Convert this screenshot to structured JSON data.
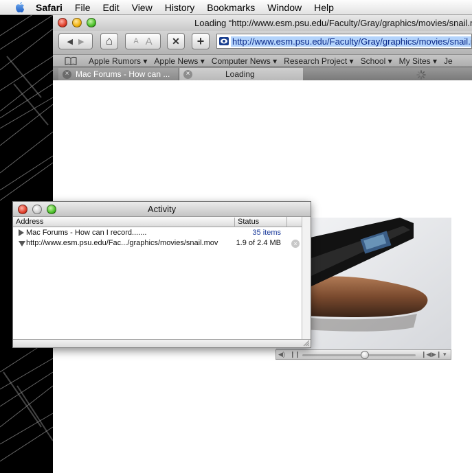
{
  "menubar": {
    "app": "Safari",
    "items": [
      "File",
      "Edit",
      "View",
      "History",
      "Bookmarks",
      "Window",
      "Help"
    ]
  },
  "browser": {
    "title": "Loading “http://www.esm.psu.edu/Faculty/Gray/graphics/movies/snail.mov”",
    "address": "http://www.esm.psu.edu/Faculty/Gray/graphics/movies/snail.mov",
    "toolbar": {
      "back": "◀",
      "forward": "▶",
      "home": "⌂",
      "text_smaller": "A",
      "text_bigger": "A",
      "stop": "✕",
      "add_bookmark": "+"
    },
    "bookmarks": [
      "Apple Rumors ▾",
      "Apple News ▾",
      "Computer News ▾",
      "Research Project ▾",
      "School ▾",
      "My Sites ▾",
      "Je"
    ],
    "tabs": [
      {
        "label": "Mac Forums - How can ...",
        "close": "×"
      },
      {
        "label": "Loading",
        "close": "×"
      }
    ]
  },
  "activity": {
    "title": "Activity",
    "columns": {
      "address": "Address",
      "status": "Status"
    },
    "rows": [
      {
        "address": "Mac Forums - How can I record.......",
        "status": "35 items"
      },
      {
        "address": "http://www.esm.psu.edu/Fac.../graphics/movies/snail.mov",
        "status": "1.9 of 2.4 MB"
      }
    ],
    "stop_glyph": "×"
  },
  "movie": {
    "controls": {
      "volume": "◀)",
      "play": "❙❙",
      "step_back": "❙◀",
      "step_forward": "▶❙",
      "menu": "▾"
    },
    "progress": 0.55
  }
}
